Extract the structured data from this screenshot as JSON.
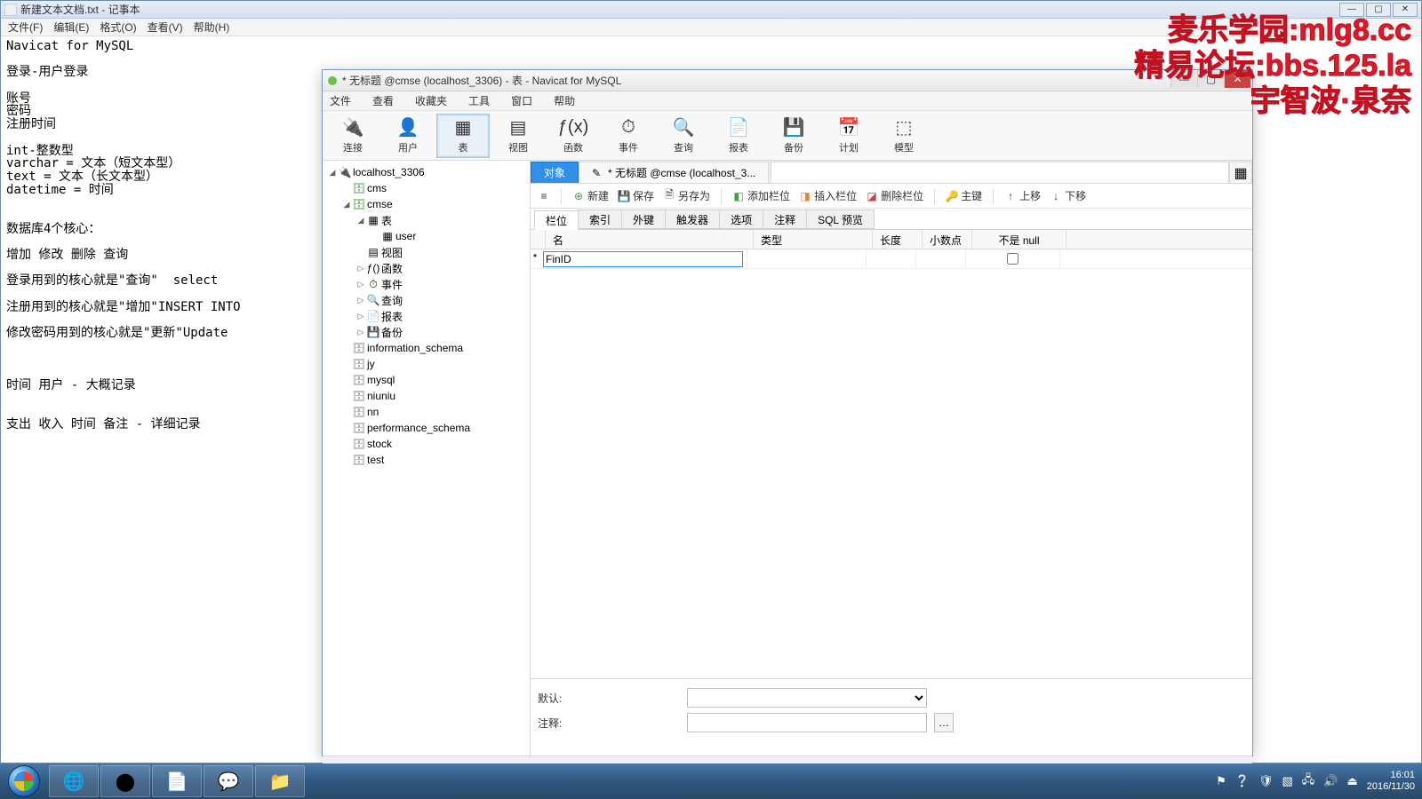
{
  "notepad": {
    "title": "新建文本文档.txt - 记事本",
    "menu": [
      "文件(F)",
      "编辑(E)",
      "格式(O)",
      "查看(V)",
      "帮助(H)"
    ],
    "body": "Navicat for MySQL\n\n登录-用户登录\n\n账号\n密码\n注册时间\n\nint-整数型\nvarchar = 文本（短文本型）\ntext = 文本（长文本型）\ndatetime = 时间\n\n\n数据库4个核心：\n\n增加 修改 删除 查询\n\n登录用到的核心就是\"查询\"  select\n\n注册用到的核心就是\"增加\"INSERT INTO\n\n修改密码用到的核心就是\"更新\"Update\n\n\n\n时间 用户 - 大概记录\n\n\n支出 收入 时间 备注 - 详细记录"
  },
  "navicat": {
    "title": "* 无标题 @cmse (localhost_3306) - 表 - Navicat for MySQL",
    "menu": [
      "文件",
      "查看",
      "收藏夹",
      "工具",
      "窗口",
      "帮助"
    ],
    "toolbar": [
      {
        "label": "连接",
        "icon": "🔌"
      },
      {
        "label": "用户",
        "icon": "👤"
      },
      {
        "label": "表",
        "icon": "▦",
        "active": true
      },
      {
        "label": "视图",
        "icon": "▤"
      },
      {
        "label": "函数",
        "icon": "ƒ(x)"
      },
      {
        "label": "事件",
        "icon": "⏱"
      },
      {
        "label": "查询",
        "icon": "🔍"
      },
      {
        "label": "报表",
        "icon": "📄"
      },
      {
        "label": "备份",
        "icon": "💾"
      },
      {
        "label": "计划",
        "icon": "📅"
      },
      {
        "label": "模型",
        "icon": "⬚"
      }
    ],
    "tree": {
      "conn": "localhost_3306",
      "dbs_open": [
        "cms"
      ],
      "db_active": "cmse",
      "cmse_children": [
        {
          "label": "表",
          "kind": "folder",
          "open": true,
          "children": [
            "user"
          ]
        },
        {
          "label": "视图",
          "kind": "view"
        },
        {
          "label": "函数",
          "kind": "fx"
        },
        {
          "label": "事件",
          "kind": "event"
        },
        {
          "label": "查询",
          "kind": "query"
        },
        {
          "label": "报表",
          "kind": "report"
        },
        {
          "label": "备份",
          "kind": "backup"
        }
      ],
      "other_dbs": [
        "information_schema",
        "jy",
        "mysql",
        "niuniu",
        "nn",
        "performance_schema",
        "stock",
        "test"
      ]
    },
    "main_tabs": {
      "object": "对象",
      "current": "* 无标题 @cmse (localhost_3..."
    },
    "actions": {
      "menu": "≡",
      "new": "新建",
      "save": "保存",
      "saveas": "另存为",
      "addcol": "添加栏位",
      "inscol": "插入栏位",
      "delcol": "删除栏位",
      "pk": "主键",
      "up": "上移",
      "down": "下移"
    },
    "design_tabs": [
      "栏位",
      "索引",
      "外键",
      "触发器",
      "选项",
      "注释",
      "SQL 预览"
    ],
    "columns": {
      "name": "名",
      "type": "类型",
      "len": "长度",
      "dec": "小数点",
      "null": "不是 null"
    },
    "row": {
      "name": "FinID"
    },
    "bottom": {
      "default": "默认:",
      "comment": "注释:"
    }
  },
  "watermark": {
    "l1": "麦乐学园:mlg8.cc",
    "l2": "精易论坛:bbs.125.la",
    "l3": "宇智波·泉奈"
  },
  "taskbar": {
    "apps": [
      "chrome",
      "obs",
      "notepad",
      "wechat",
      "explorer"
    ],
    "time": "16:01",
    "date": "2016/11/30"
  }
}
